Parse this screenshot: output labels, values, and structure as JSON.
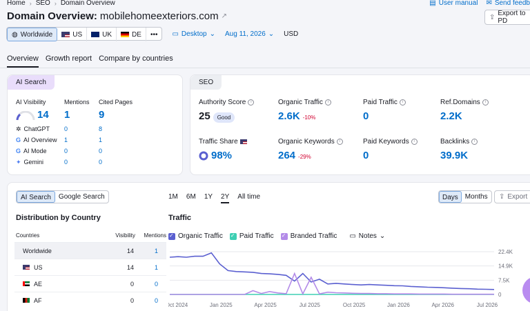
{
  "breadcrumb": [
    "Home",
    "SEO",
    "Domain Overview"
  ],
  "top_links": {
    "manual": "User manual",
    "feedback": "Send feedb"
  },
  "header": {
    "title": "Domain Overview:",
    "domain": "mobilehomeexteriors.com",
    "export": "Export to PD"
  },
  "filters": {
    "regions": [
      "Worldwide",
      "US",
      "UK",
      "DE"
    ],
    "more": "•••",
    "device": "Desktop",
    "date": "Aug 11, 2026",
    "currency": "USD"
  },
  "tabs": [
    "Overview",
    "Growth report",
    "Compare by countries"
  ],
  "ai_card": {
    "tag": "AI Search",
    "headers": {
      "visibility": "AI Visibility",
      "mentions": "Mentions",
      "cited": "Cited Pages"
    },
    "visibility": "14",
    "mentions": "1",
    "cited": "9",
    "rows": [
      {
        "name": "ChatGPT",
        "mentions": "0",
        "cited": "8"
      },
      {
        "name": "AI Overview",
        "mentions": "1",
        "cited": "1"
      },
      {
        "name": "AI Mode",
        "mentions": "0",
        "cited": "0"
      },
      {
        "name": "Gemini",
        "mentions": "0",
        "cited": "0"
      }
    ]
  },
  "seo_card": {
    "tag": "SEO",
    "authority": {
      "label": "Authority Score",
      "value": "25",
      "badge": "Good"
    },
    "organic_traffic": {
      "label": "Organic Traffic",
      "value": "2.6K",
      "delta": "-10%"
    },
    "paid_traffic": {
      "label": "Paid Traffic",
      "value": "0"
    },
    "ref_domains": {
      "label": "Ref.Domains",
      "value": "2.2K"
    },
    "traffic_share": {
      "label": "Traffic Share",
      "value": "98%"
    },
    "organic_keywords": {
      "label": "Organic Keywords",
      "value": "264",
      "delta": "-29%"
    },
    "paid_keywords": {
      "label": "Paid Keywords",
      "value": "0"
    },
    "backlinks": {
      "label": "Backlinks",
      "value": "39.9K"
    }
  },
  "bottom": {
    "toggle": [
      "AI Search",
      "Google Search"
    ],
    "ranges": [
      "1M",
      "6M",
      "1Y",
      "2Y",
      "All time"
    ],
    "range_active": "2Y",
    "granularity": [
      "Days",
      "Months"
    ],
    "export": "Export",
    "dist_title": "Distribution by Country",
    "cols": {
      "country": "Countries",
      "visibility": "Visibility",
      "mentions": "Mentions"
    },
    "countries": [
      {
        "name": "Worldwide",
        "visibility": "14",
        "mentions": "1"
      },
      {
        "name": "US",
        "visibility": "14",
        "mentions": "1"
      },
      {
        "name": "AE",
        "visibility": "0",
        "mentions": "0"
      },
      {
        "name": "AF",
        "visibility": "0",
        "mentions": "0"
      }
    ],
    "traffic_title": "Traffic",
    "legend": [
      "Organic Traffic",
      "Paid Traffic",
      "Branded Traffic"
    ],
    "notes": "Notes"
  },
  "chart_data": {
    "type": "line",
    "x_labels": [
      "Oct 2024",
      "Jan 2025",
      "Apr 2025",
      "Jul 2025",
      "Oct 2025",
      "Jan 2026",
      "Apr 2026",
      "Jul 2026"
    ],
    "y_ticks": [
      "22.4K",
      "14.9K",
      "7.5K",
      "0"
    ],
    "ylim": [
      0,
      22400
    ],
    "series": [
      {
        "name": "Organic Traffic",
        "color": "#5a5fd0",
        "values": [
          19500,
          19800,
          19500,
          20000,
          20000,
          21800,
          16000,
          12500,
          12000,
          11800,
          11600,
          11000,
          10800,
          10500,
          10000,
          7000,
          11000,
          6500,
          8000,
          5500,
          5800,
          5500,
          5200,
          5000,
          5200,
          5000,
          4800,
          4600,
          4500,
          4200,
          4000,
          3800,
          3700,
          3500,
          3300,
          3100,
          3000,
          2800,
          2700,
          2600
        ]
      },
      {
        "name": "Paid Traffic",
        "color": "#3ecfb3",
        "values": [
          0,
          0,
          0,
          0,
          0,
          0,
          0,
          0,
          0,
          0,
          0,
          0,
          0,
          0,
          0,
          0,
          0,
          0,
          0,
          0,
          0,
          0,
          0,
          0,
          0,
          0,
          0,
          0,
          0,
          0,
          0,
          0,
          0,
          0,
          0,
          0,
          0,
          0,
          0,
          0
        ]
      },
      {
        "name": "Branded Traffic",
        "color": "#b38be8",
        "values": [
          0,
          0,
          0,
          0,
          0,
          0,
          0,
          0,
          0,
          0,
          2000,
          500,
          1500,
          800,
          400,
          11000,
          300,
          9000,
          300,
          1200,
          900,
          800,
          600,
          500,
          500,
          400,
          400,
          300,
          300,
          300,
          200,
          200,
          200,
          200,
          100,
          100,
          100,
          100,
          100,
          100
        ]
      }
    ]
  },
  "colors": {
    "accent": "#006dca",
    "ai_tag": "#e9ddfb",
    "seo_tag": "#eceef2",
    "good": "#dfe6fa"
  }
}
